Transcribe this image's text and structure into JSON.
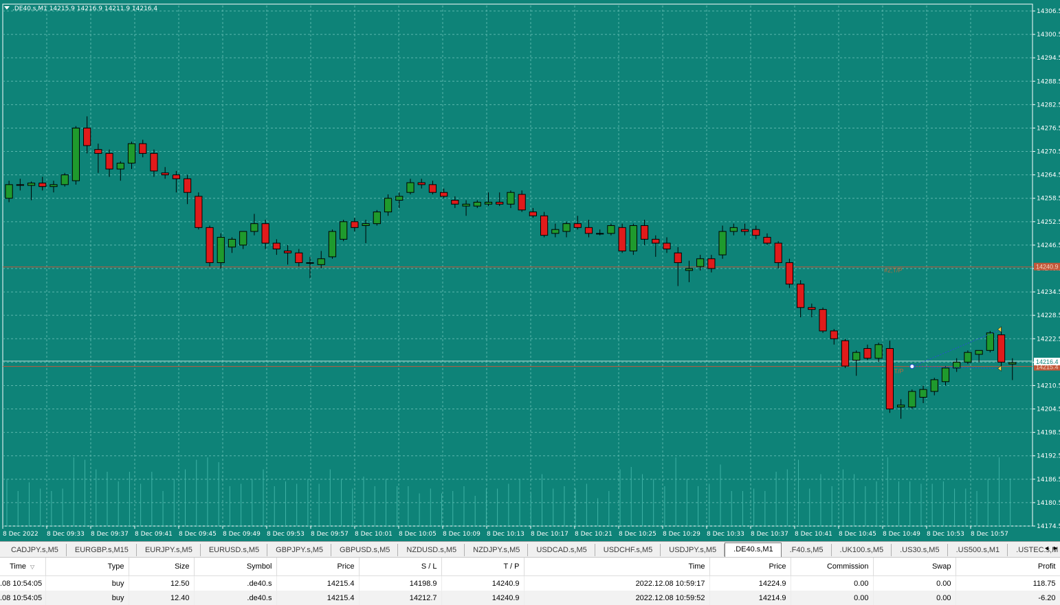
{
  "chart": {
    "header": ".DE40.s,M1  14215.9 14216.9 14211.9 14216.4",
    "bg_color": "#0e8378",
    "bull_color": "#1f9a2d",
    "bear_color": "#e01b1b",
    "grid_color": "#5bb7ad",
    "price_axis": [
      "14306.5",
      "14300.5",
      "14294.5",
      "14288.5",
      "14282.5",
      "14276.5",
      "14270.5",
      "14264.5",
      "14258.5",
      "14252.5",
      "14246.5",
      "14240.5",
      "14234.5",
      "14228.5",
      "14222.5",
      "14216.5",
      "14210.5",
      "14204.5",
      "14198.5",
      "14192.5",
      "14186.5",
      "14180.5",
      "14174.5"
    ],
    "time_axis": [
      "8 Dec 2022",
      "8 Dec 09:33",
      "8 Dec 09:37",
      "8 Dec 09:41",
      "8 Dec 09:45",
      "8 Dec 09:49",
      "8 Dec 09:53",
      "8 Dec 09:57",
      "8 Dec 10:01",
      "8 Dec 10:05",
      "8 Dec 10:09",
      "8 Dec 10:13",
      "8 Dec 10:17",
      "8 Dec 10:21",
      "8 Dec 10:25",
      "8 Dec 10:29",
      "8 Dec 10:33",
      "8 Dec 10:37",
      "8 Dec 10:41",
      "8 Dec 10:45",
      "8 Dec 10:49",
      "8 Dec 10:53",
      "8 Dec 10:57"
    ],
    "price_range": [
      14174.5,
      14306.5
    ],
    "current_price_label": "14216.4",
    "tp_line": {
      "price": 14240.9,
      "label": "#2;T/P",
      "tag": "14240.9"
    },
    "sl_line": {
      "price": 14215.4,
      "label": "#2;T/P",
      "tag": "14215.4"
    },
    "candles": [
      [
        14258.5,
        14263.0,
        14257.5,
        14262.0
      ],
      [
        14262.0,
        14263.5,
        14260.5,
        14261.8
      ],
      [
        14261.8,
        14262.8,
        14258.0,
        14262.4
      ],
      [
        14262.4,
        14264.0,
        14260.5,
        14261.5
      ],
      [
        14261.5,
        14263.0,
        14260.0,
        14262.0
      ],
      [
        14262.0,
        14265.0,
        14261.5,
        14264.5
      ],
      [
        14263.0,
        14277.0,
        14262.0,
        14276.5
      ],
      [
        14276.5,
        14279.5,
        14270.0,
        14272.0
      ],
      [
        14271.0,
        14272.5,
        14265.0,
        14270.0
      ],
      [
        14270.0,
        14271.0,
        14264.0,
        14266.0
      ],
      [
        14266.0,
        14268.0,
        14263.0,
        14267.5
      ],
      [
        14267.5,
        14273.0,
        14266.0,
        14272.5
      ],
      [
        14272.5,
        14273.5,
        14269.0,
        14270.0
      ],
      [
        14270.0,
        14271.0,
        14264.0,
        14265.5
      ],
      [
        14265.0,
        14266.5,
        14263.5,
        14264.5
      ],
      [
        14264.5,
        14265.5,
        14260.0,
        14263.5
      ],
      [
        14263.5,
        14264.5,
        14257.0,
        14260.0
      ],
      [
        14259.0,
        14260.0,
        14250.5,
        14251.0
      ],
      [
        14251.0,
        14251.5,
        14241.0,
        14242.0
      ],
      [
        14242.0,
        14249.5,
        14240.5,
        14248.5
      ],
      [
        14246.0,
        14248.5,
        14244.5,
        14248.0
      ],
      [
        14246.5,
        14250.0,
        14245.5,
        14250.0
      ],
      [
        14250.0,
        14254.5,
        14249.0,
        14252.0
      ],
      [
        14252.0,
        14253.0,
        14245.5,
        14247.0
      ],
      [
        14247.0,
        14248.0,
        14244.0,
        14245.5
      ],
      [
        14245.0,
        14246.5,
        14241.5,
        14244.5
      ],
      [
        14244.5,
        14245.5,
        14241.0,
        14242.0
      ],
      [
        14242.0,
        14243.5,
        14238.0,
        14242.0
      ],
      [
        14241.5,
        14245.0,
        14240.5,
        14243.0
      ],
      [
        14243.5,
        14250.5,
        14243.0,
        14250.0
      ],
      [
        14248.0,
        14253.0,
        14247.5,
        14252.5
      ],
      [
        14252.5,
        14253.5,
        14250.0,
        14251.0
      ],
      [
        14251.5,
        14253.0,
        14247.0,
        14252.0
      ],
      [
        14252.0,
        14255.5,
        14251.5,
        14255.0
      ],
      [
        14255.0,
        14259.5,
        14254.0,
        14258.5
      ],
      [
        14258.0,
        14260.0,
        14256.0,
        14259.0
      ],
      [
        14260.0,
        14263.5,
        14259.5,
        14262.5
      ],
      [
        14262.5,
        14263.5,
        14261.0,
        14262.0
      ],
      [
        14262.0,
        14263.0,
        14259.5,
        14260.0
      ],
      [
        14260.0,
        14261.0,
        14258.5,
        14259.0
      ],
      [
        14258.0,
        14259.0,
        14256.0,
        14257.0
      ],
      [
        14256.5,
        14258.0,
        14254.0,
        14257.0
      ],
      [
        14256.5,
        14258.0,
        14256.0,
        14257.5
      ],
      [
        14257.0,
        14260.0,
        14256.5,
        14257.5
      ],
      [
        14257.5,
        14260.0,
        14256.5,
        14257.0
      ],
      [
        14257.0,
        14260.5,
        14256.0,
        14260.0
      ],
      [
        14259.5,
        14260.5,
        14255.0,
        14255.5
      ],
      [
        14255.0,
        14256.0,
        14253.5,
        14254.0
      ],
      [
        14254.0,
        14255.0,
        14248.5,
        14249.0
      ],
      [
        14249.5,
        14252.0,
        14248.5,
        14250.5
      ],
      [
        14250.0,
        14252.5,
        14248.5,
        14252.0
      ],
      [
        14252.0,
        14254.0,
        14250.5,
        14251.0
      ],
      [
        14251.0,
        14253.0,
        14248.5,
        14249.5
      ],
      [
        14249.5,
        14250.5,
        14249.0,
        14249.5
      ],
      [
        14249.5,
        14252.0,
        14249.0,
        14251.5
      ],
      [
        14251.0,
        14252.0,
        14244.5,
        14245.0
      ],
      [
        14245.0,
        14252.0,
        14244.0,
        14251.5
      ],
      [
        14251.5,
        14253.0,
        14246.5,
        14248.0
      ],
      [
        14248.0,
        14249.0,
        14243.5,
        14247.0
      ],
      [
        14247.0,
        14248.5,
        14244.5,
        14245.5
      ],
      [
        14244.5,
        14246.0,
        14236.0,
        14242.0
      ],
      [
        14240.0,
        14242.5,
        14237.0,
        14240.5
      ],
      [
        14241.0,
        14244.0,
        14240.0,
        14243.0
      ],
      [
        14243.0,
        14244.0,
        14239.5,
        14240.5
      ],
      [
        14244.0,
        14251.5,
        14243.0,
        14250.0
      ],
      [
        14250.0,
        14252.0,
        14249.0,
        14251.0
      ],
      [
        14250.5,
        14252.0,
        14249.0,
        14250.0
      ],
      [
        14250.5,
        14251.5,
        14248.0,
        14249.0
      ],
      [
        14248.5,
        14249.5,
        14246.5,
        14247.0
      ],
      [
        14247.0,
        14247.5,
        14240.5,
        14242.0
      ],
      [
        14242.0,
        14243.0,
        14235.5,
        14236.5
      ],
      [
        14236.5,
        14237.5,
        14228.0,
        14230.5
      ],
      [
        14230.5,
        14231.5,
        14228.0,
        14230.0
      ],
      [
        14230.0,
        14230.5,
        14224.0,
        14224.5
      ],
      [
        14224.5,
        14225.0,
        14221.0,
        14222.5
      ],
      [
        14222.0,
        14222.5,
        14215.0,
        14215.5
      ],
      [
        14217.0,
        14219.5,
        14213.0,
        14219.0
      ],
      [
        14220.0,
        14221.0,
        14217.0,
        14217.5
      ],
      [
        14217.5,
        14221.5,
        14216.5,
        14221.0
      ],
      [
        14220.0,
        14222.0,
        14203.5,
        14204.5
      ],
      [
        14205.0,
        14207.0,
        14202.0,
        14205.5
      ],
      [
        14205.0,
        14209.5,
        14204.5,
        14209.0
      ],
      [
        14207.5,
        14210.5,
        14206.0,
        14209.5
      ],
      [
        14209.0,
        14212.5,
        14208.0,
        14212.0
      ],
      [
        14211.5,
        14215.5,
        14210.5,
        14215.0
      ],
      [
        14215.0,
        14217.5,
        14214.0,
        14216.5
      ],
      [
        14216.5,
        14219.5,
        14216.0,
        14219.0
      ],
      [
        14218.5,
        14219.5,
        14216.5,
        14219.5
      ],
      [
        14219.5,
        14224.5,
        14219.0,
        14224.0
      ],
      [
        14223.5,
        14225.5,
        14215.5,
        14216.5
      ],
      [
        14216.0,
        14217.5,
        14211.9,
        14216.4
      ]
    ]
  },
  "tabs": [
    "CADJPY.s,M5",
    "EURGBP.s,M15",
    "EURJPY.s,M5",
    "EURUSD.s,M5",
    "GBPJPY.s,M5",
    "GBPUSD.s,M5",
    "NZDUSD.s,M5",
    "NZDJPY.s,M5",
    "USDCAD.s,M5",
    "USDCHF.s,M5",
    "USDJPY.s,M5",
    ".DE40.s,M1",
    ".F40.s,M5",
    ".UK100.s,M5",
    ".US30.s,M5",
    ".US500.s,M1",
    ".USTEC.s,M"
  ],
  "active_tab": ".DE40.s,M1",
  "tab_scroll": {
    "left": "◄",
    "right": "►"
  },
  "trades": {
    "columns": [
      "Time",
      "Type",
      "Size",
      "Symbol",
      "Price",
      "S / L",
      "T / P",
      "Time",
      "Price",
      "Commission",
      "Swap",
      "Profit"
    ],
    "rows": [
      [
        ".08 10:54:05",
        "buy",
        "12.50",
        ".de40.s",
        "14215.4",
        "14198.9",
        "14240.9",
        "2022.12.08 10:59:17",
        "14224.9",
        "0.00",
        "0.00",
        "118.75"
      ],
      [
        ".08 10:54:05",
        "buy",
        "12.40",
        ".de40.s",
        "14215.4",
        "14212.7",
        "14240.9",
        "2022.12.08 10:59:52",
        "14214.9",
        "0.00",
        "0.00",
        "-6.20"
      ]
    ]
  }
}
